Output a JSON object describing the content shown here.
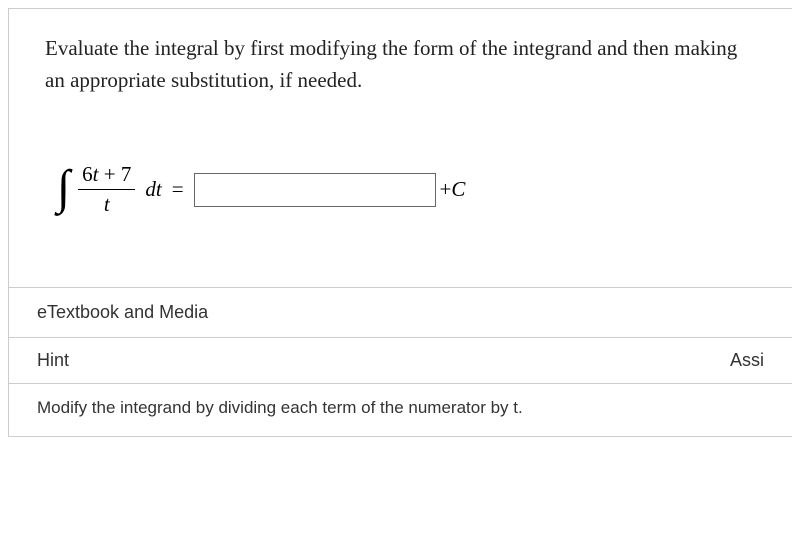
{
  "question": {
    "prompt": "Evaluate the integral by first modifying the form of the integrand and then making an appropriate substitution, if needed."
  },
  "integral": {
    "numerator_coeff": "6",
    "numerator_var": "t",
    "numerator_plus": " + 7",
    "denominator": "t",
    "differential_d": "d",
    "differential_var": "t",
    "equals": "=",
    "answer_value": "",
    "plus": "+",
    "constant": "C"
  },
  "accordion": {
    "etextbook_label": "eTextbook and Media",
    "hint_label": "Hint",
    "assistance_label": "Assi"
  },
  "hint": {
    "text": "Modify the integrand by dividing each term of the numerator by t."
  }
}
